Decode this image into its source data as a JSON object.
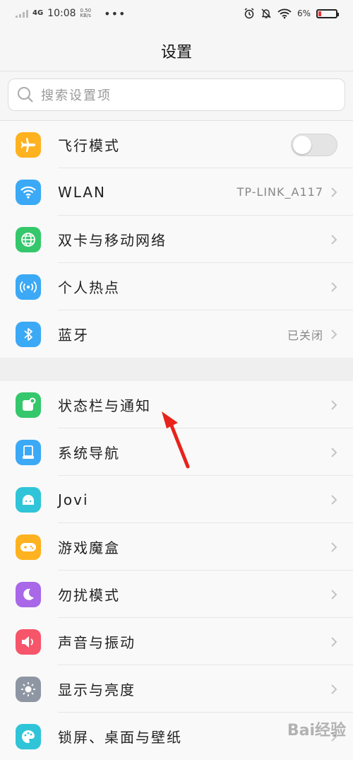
{
  "status_bar": {
    "network": "4G",
    "time": "10:08",
    "speed_value": "0.50",
    "speed_unit": "KB/s",
    "overflow": "•••",
    "battery": "6%"
  },
  "page": {
    "title": "设置"
  },
  "search": {
    "placeholder": "搜索设置项"
  },
  "group1": [
    {
      "label": "飞行模式",
      "type": "toggle",
      "toggle_on": false,
      "icon": "airplane-icon",
      "color": "#FFB21F"
    },
    {
      "label": "WLAN",
      "value": "TP-LINK_A117",
      "icon": "wifi-icon",
      "color": "#3BA9F5"
    },
    {
      "label": "双卡与移动网络",
      "icon": "globe-icon",
      "color": "#35C76B"
    },
    {
      "label": "个人热点",
      "icon": "hotspot-icon",
      "color": "#3BA9F5"
    },
    {
      "label": "蓝牙",
      "value": "已关闭",
      "icon": "bluetooth-icon",
      "color": "#3BA9F5"
    }
  ],
  "group2": [
    {
      "label": "状态栏与通知",
      "icon": "notification-icon",
      "color": "#35C76B"
    },
    {
      "label": "系统导航",
      "icon": "navigation-icon",
      "color": "#3BA9F5"
    },
    {
      "label": "Jovi",
      "icon": "jovi-icon",
      "color": "#2FC4D8"
    },
    {
      "label": "游戏魔盒",
      "icon": "gamepad-icon",
      "color": "#FFB21F"
    },
    {
      "label": "勿扰模式",
      "icon": "moon-icon",
      "color": "#A868E8"
    },
    {
      "label": "声音与振动",
      "icon": "speaker-icon",
      "color": "#F7556A"
    },
    {
      "label": "显示与亮度",
      "icon": "brightness-icon",
      "color": "#8E96A3"
    },
    {
      "label": "锁屏、桌面与壁纸",
      "icon": "palette-icon",
      "color": "#2FC4D8"
    }
  ],
  "watermark": "Bai经验"
}
